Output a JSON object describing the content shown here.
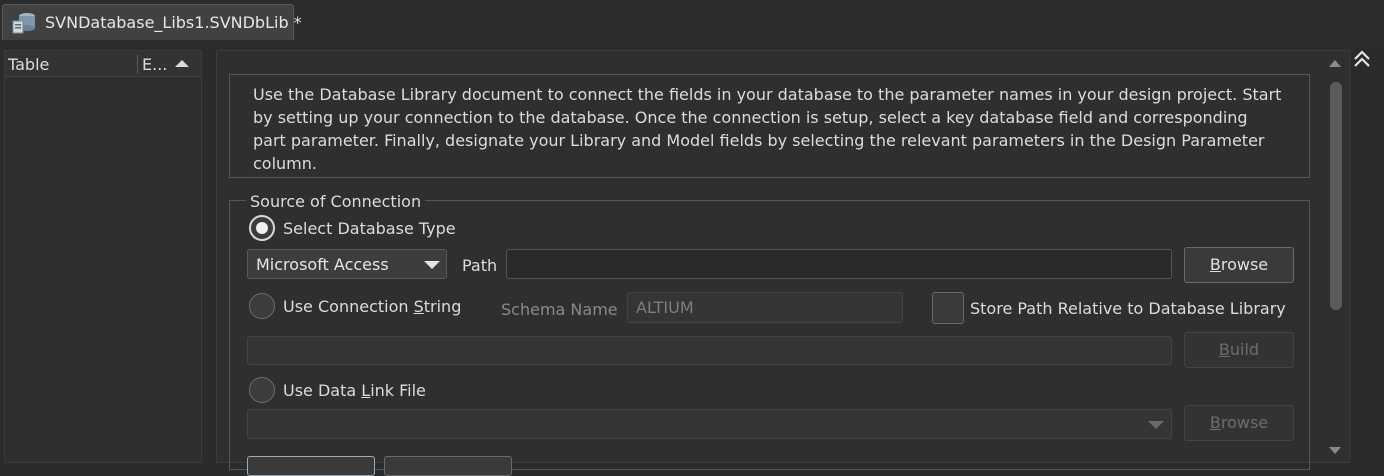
{
  "tab": {
    "title": "SVNDatabase_Libs1.SVNDbLib *",
    "icon": "database-library-icon"
  },
  "left_panel": {
    "columns": [
      "Table",
      "E..."
    ]
  },
  "info_text": "Use the Database Library document to connect the fields in your database to the parameter names in your design project. Start by setting up your connection to the database. Once the connection is setup, select a key database field and corresponding part parameter. Finally, designate your Library and Model fields by selecting the relevant parameters in the Design Parameter column.",
  "source": {
    "title": "Source of Connection",
    "select_db_type": {
      "label": "Select Database Type",
      "selected": true
    },
    "db_type": "Microsoft Access",
    "path_label": "Path",
    "path_value": "",
    "browse": {
      "accel": "B",
      "rest": "rowse"
    },
    "conn_string": {
      "pre": "Use Connection ",
      "accel": "S",
      "post": "tring",
      "selected": false
    },
    "schema_label": "Schema Name",
    "schema_value": "ALTIUM",
    "store_relative": {
      "label": "Store Path Relative to Database Library",
      "checked": false
    },
    "build": {
      "accel": "B",
      "rest": "uild"
    },
    "data_link": {
      "pre": "Use Data ",
      "accel": "L",
      "post": "ink File",
      "selected": false
    },
    "browse2": {
      "accel": "B",
      "rest": "rowse"
    }
  },
  "colors": {
    "background": "#2b2b2b",
    "panel": "#2f2f2f",
    "text": "#dcdcdc"
  }
}
